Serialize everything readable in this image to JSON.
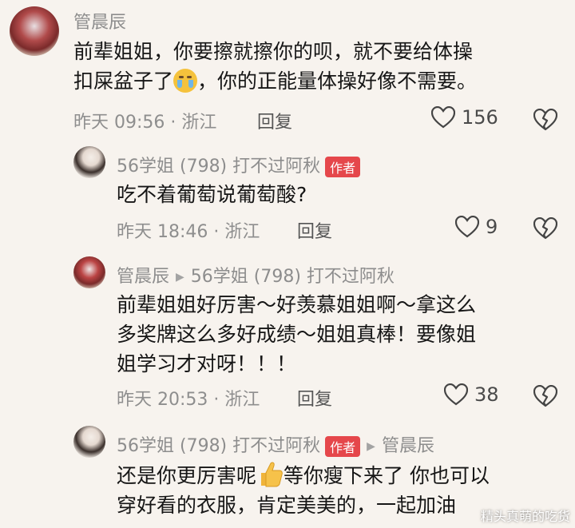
{
  "comments": [
    {
      "author": "管晨辰",
      "text_line1": "前辈姐姐，你要擦就擦你的呗，就不要给体操",
      "text_line2_a": "扣屎盆子了",
      "text_line2_b": "，你的正能量体操好像不需要。",
      "time": "昨天 09:56 · 浙江",
      "reply_label": "回复",
      "likes": "156"
    },
    {
      "author": "56学姐 (798) 打不过阿秋",
      "badge": "作者",
      "text": "吃不着葡萄说葡萄酸?",
      "time": "昨天 18:46 · 浙江",
      "reply_label": "回复",
      "likes": "9"
    },
    {
      "author": "管晨辰",
      "reply_to": "56学姐 (798) 打不过阿秋",
      "text_line1": "前辈姐姐好厉害～好羡慕姐姐啊～拿这么",
      "text_line2": "多奖牌这么多好成绩～姐姐真棒！要像姐",
      "text_line3": "姐学习才对呀！！！",
      "time": "昨天 20:53 · 浙江",
      "reply_label": "回复",
      "likes": "38"
    },
    {
      "author": "56学姐 (798) 打不过阿秋",
      "badge": "作者",
      "reply_to": "管晨辰",
      "text_line1_a": "还是你更厉害呢",
      "text_line1_b": "等你瘦下来了 你也可以",
      "text_line2": "穿好看的衣服，肯定美美的，一起加油"
    }
  ],
  "watermark": "精头真萌的吃货",
  "icons": {
    "like": "heart-outline-icon",
    "dislike": "broken-heart-icon",
    "arrow": "triangle-right-icon",
    "crying": "crying-face-emoji",
    "thumbs": "thumbs-up-emoji"
  },
  "colors": {
    "badge": "#e5474b",
    "background": "#f7f3ee",
    "meta": "#8e8e8e"
  }
}
